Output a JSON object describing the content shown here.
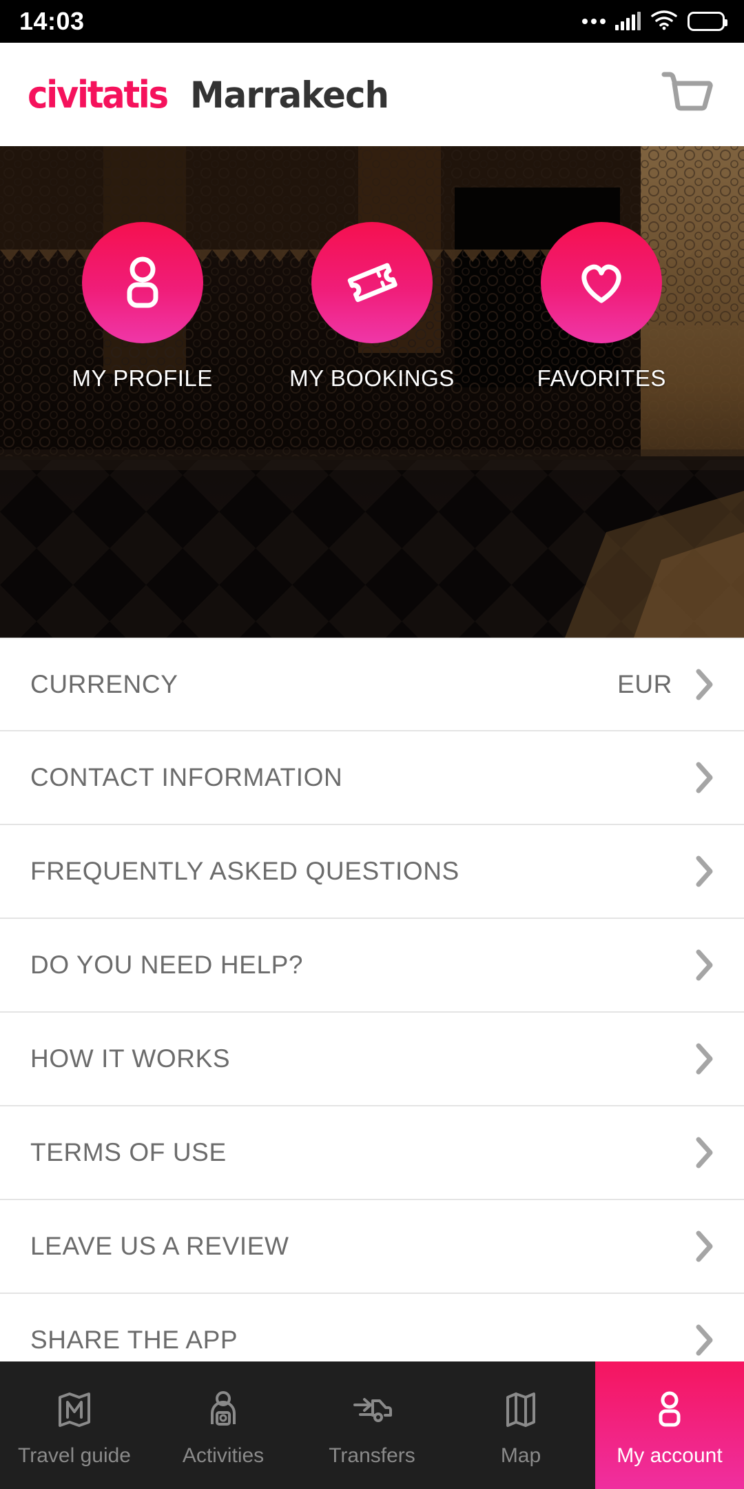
{
  "statusbar": {
    "time": "14:03",
    "icons": [
      "more-dots-icon",
      "signal-bars-icon",
      "wifi-icon",
      "battery-icon"
    ]
  },
  "header": {
    "brand": "civitatis",
    "city": "Marrakech",
    "brand_color": "#f5125c",
    "city_color": "#333333",
    "cart_icon": "shopping-cart-icon"
  },
  "hero": {
    "background_description": "dark moroccan courtyard with carved stucco and checkered tiled floor",
    "shortcuts": [
      {
        "label": "MY PROFILE",
        "icon": "person-icon"
      },
      {
        "label": "MY BOOKINGS",
        "icon": "ticket-icon"
      },
      {
        "label": "FAVORITES",
        "icon": "heart-icon"
      }
    ],
    "circle_gradient_from": "#f5104f",
    "circle_gradient_to": "#ef37a8"
  },
  "menu": {
    "rows": [
      {
        "label": "CURRENCY",
        "value": "EUR",
        "chevron": "chevron-right-icon"
      },
      {
        "label": "CONTACT INFORMATION",
        "value": "",
        "chevron": "chevron-right-icon"
      },
      {
        "label": "FREQUENTLY ASKED QUESTIONS",
        "value": "",
        "chevron": "chevron-right-icon"
      },
      {
        "label": "DO YOU NEED HELP?",
        "value": "",
        "chevron": "chevron-right-icon"
      },
      {
        "label": "HOW IT WORKS",
        "value": "",
        "chevron": "chevron-right-icon"
      },
      {
        "label": "TERMS OF USE",
        "value": "",
        "chevron": "chevron-right-icon"
      },
      {
        "label": "LEAVE US A REVIEW",
        "value": "",
        "chevron": "chevron-right-icon"
      },
      {
        "label": "SHARE THE APP",
        "value": "",
        "chevron": "chevron-right-icon"
      }
    ]
  },
  "bottomnav": {
    "active_color_from": "#f5155f",
    "active_color_to": "#ef2f9f",
    "items": [
      {
        "label": "Travel guide",
        "icon": "folded-map-guide-icon",
        "active": false
      },
      {
        "label": "Activities",
        "icon": "person-camera-icon",
        "active": false
      },
      {
        "label": "Transfers",
        "icon": "arrow-car-icon",
        "active": false
      },
      {
        "label": "Map",
        "icon": "folded-map-icon",
        "active": false
      },
      {
        "label": "My account",
        "icon": "person-icon",
        "active": true
      }
    ]
  }
}
